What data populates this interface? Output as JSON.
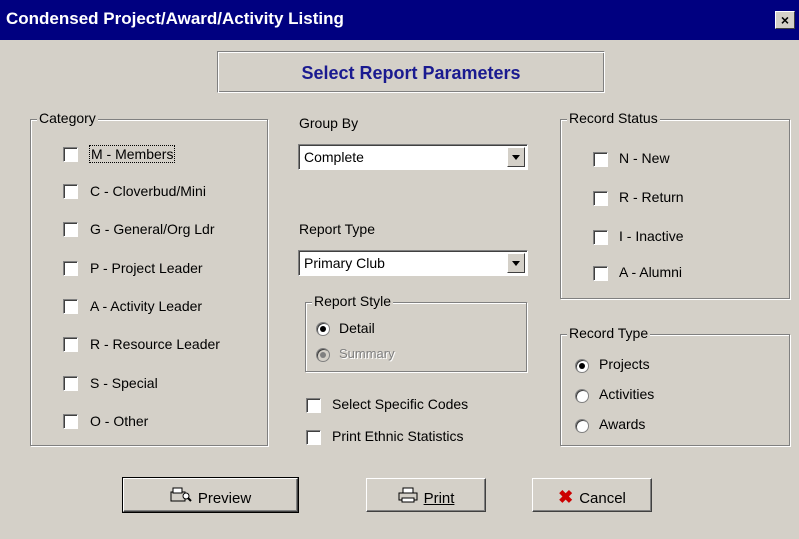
{
  "window": {
    "title": "Condensed Project/Award/Activity Listing",
    "close_label": "×"
  },
  "header": {
    "title": "Select Report Parameters"
  },
  "category": {
    "legend": "Category",
    "items": [
      {
        "label": "M - Members",
        "checked": false
      },
      {
        "label": "C - Cloverbud/Mini",
        "checked": false
      },
      {
        "label": "G - General/Org Ldr",
        "checked": false
      },
      {
        "label": "P - Project Leader",
        "checked": false
      },
      {
        "label": "A - Activity Leader",
        "checked": false
      },
      {
        "label": "R - Resource Leader",
        "checked": false
      },
      {
        "label": "S - Special",
        "checked": false
      },
      {
        "label": "O - Other",
        "checked": false
      }
    ]
  },
  "group_by": {
    "label": "Group By",
    "value": "Complete"
  },
  "report_type": {
    "label": "Report Type",
    "value": "Primary Club"
  },
  "report_style": {
    "legend": "Report Style",
    "options": [
      {
        "label": "Detail",
        "selected": true,
        "enabled": true
      },
      {
        "label": "Summary",
        "selected": false,
        "enabled": false
      }
    ]
  },
  "options": {
    "select_specific_codes": "Select Specific Codes",
    "print_ethnic_statistics": "Print Ethnic Statistics"
  },
  "record_status": {
    "legend": "Record Status",
    "items": [
      {
        "label": "N - New",
        "checked": false
      },
      {
        "label": "R - Return",
        "checked": false
      },
      {
        "label": "I  - Inactive",
        "checked": false
      },
      {
        "label": "A - Alumni",
        "checked": false
      }
    ]
  },
  "record_type": {
    "legend": "Record Type",
    "options": [
      {
        "label": "Projects",
        "selected": true
      },
      {
        "label": "Activities",
        "selected": false
      },
      {
        "label": "Awards",
        "selected": false
      }
    ]
  },
  "buttons": {
    "preview": "Preview",
    "print": "Print",
    "cancel": "Cancel"
  },
  "icons": {
    "preview": "preview-icon",
    "print": "printer-icon",
    "cancel": "red-x-icon"
  }
}
